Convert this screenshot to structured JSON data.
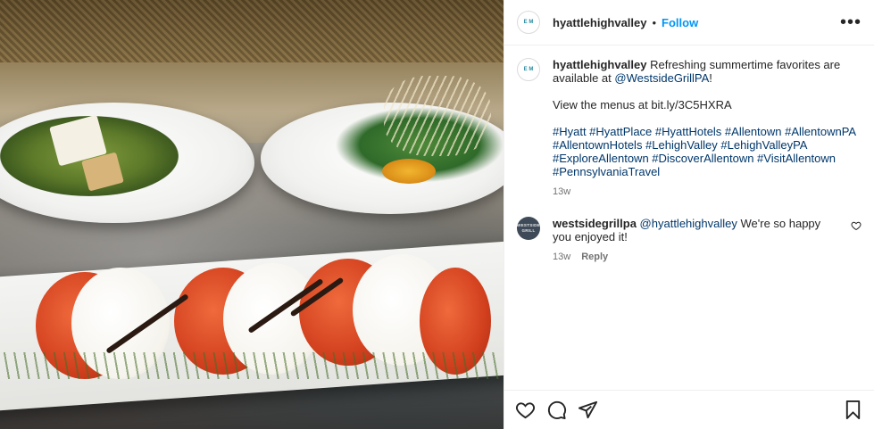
{
  "post": {
    "username": "hyattlehighvalley",
    "separator": "•",
    "follow_label": "Follow",
    "more_label": "•••"
  },
  "caption": {
    "username": "hyattlehighvalley",
    "text_before": " Refreshing summertime favorites are available at ",
    "mention": "@WestsideGrillPA",
    "text_after": "!\n\nView the menus at bit.ly/3C5HXRA\n\n",
    "hashtags": "#Hyatt #HyattPlace #HyattHotels #Allentown #AllentownPA #AllentownHotels #LehighValley #LehighValleyPA #ExploreAllentown #DiscoverAllentown #VisitAllentown #PennsylvaniaTravel",
    "time": "13w"
  },
  "comment": {
    "username": "westsidegrillpa",
    "avatar_text": "WESTSIDE GRILL",
    "mention": "@hyattlehighvalley",
    "text": " We're so happy you enjoyed it!",
    "time": "13w",
    "reply_label": "Reply"
  },
  "avatar_text": "E M",
  "icons": [
    "heart-icon",
    "comment-icon",
    "share-icon",
    "bookmark-icon",
    "more-options-icon"
  ],
  "colors": {
    "follow": "#0095f6",
    "link": "#00376b",
    "muted": "#737373"
  }
}
